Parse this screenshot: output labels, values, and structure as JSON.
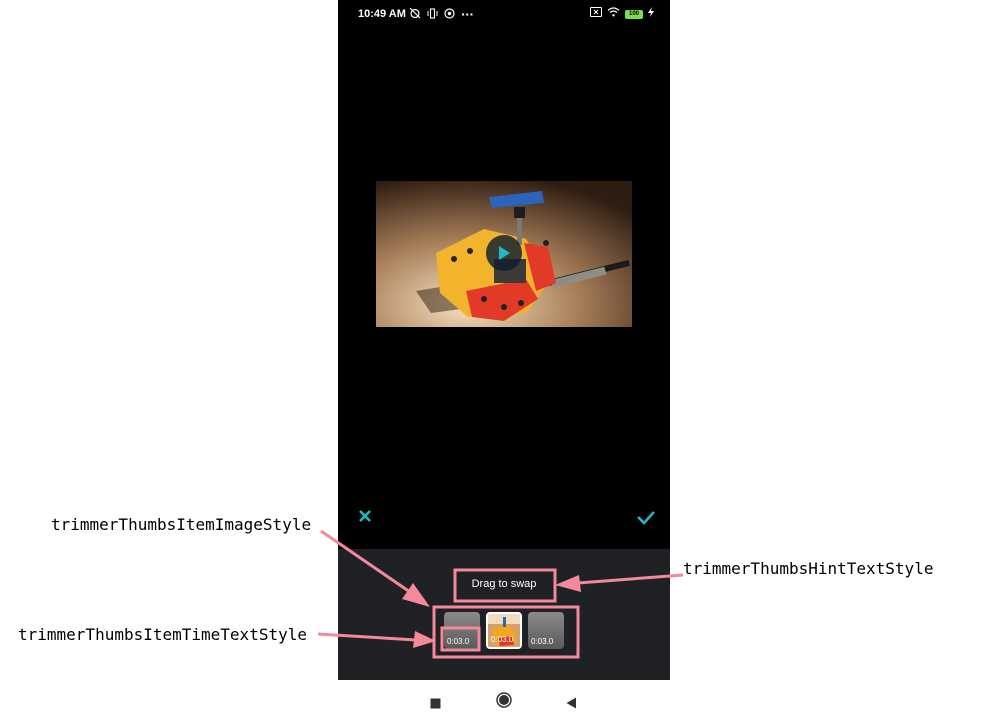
{
  "status_bar": {
    "time": "10:49 AM",
    "more": "···",
    "battery": "100"
  },
  "player": {
    "play_icon": "play-icon"
  },
  "actions": {
    "cancel_icon": "close-icon",
    "confirm_icon": "check-icon",
    "accent_color": "#20b8c8"
  },
  "trimmer": {
    "hint": "Drag to swap",
    "thumbs": [
      {
        "time": "0:03.0",
        "selected": false
      },
      {
        "time": "0:03.0",
        "selected": true
      },
      {
        "time": "0:03.0",
        "selected": false
      }
    ]
  },
  "annotations": {
    "image_style": "trimmerThumbsItemImageStyle",
    "time_text_style": "trimmerThumbsItemTimeTextStyle",
    "hint_text_style": "trimmerThumbsHintTextStyle",
    "highlight_color": "#f4899a"
  },
  "nav_bar": {
    "recents_icon": "square-icon",
    "home_icon": "circle-icon",
    "back_icon": "triangle-back-icon"
  }
}
